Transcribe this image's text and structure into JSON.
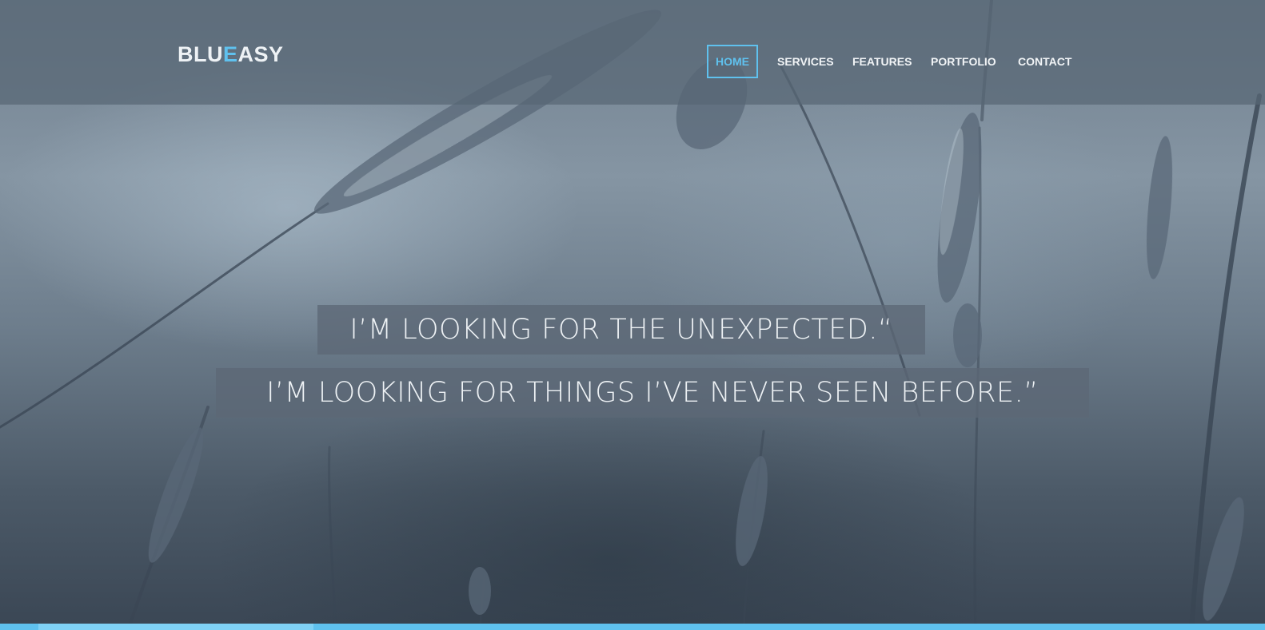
{
  "brand": {
    "part1": "BLU",
    "accent": "E",
    "part2": "ASY",
    "accent_color": "#5fc1ee"
  },
  "nav": {
    "items": [
      {
        "label": "HOME",
        "active": true
      },
      {
        "label": "SERVICES",
        "active": false
      },
      {
        "label": "FEATURES",
        "active": false
      },
      {
        "label": "PORTFOLIO",
        "active": false
      },
      {
        "label": "CONTACT",
        "active": false
      }
    ]
  },
  "hero": {
    "quote_line1": "I’M LOOKING FOR THE UNEXPECTED.“",
    "quote_line2": "I’M LOOKING FOR THINGS I’VE NEVER SEEN BEFORE.”"
  },
  "colors": {
    "accent": "#5fc1ee",
    "header_bg": "#586675",
    "text": "#eef2f5"
  }
}
